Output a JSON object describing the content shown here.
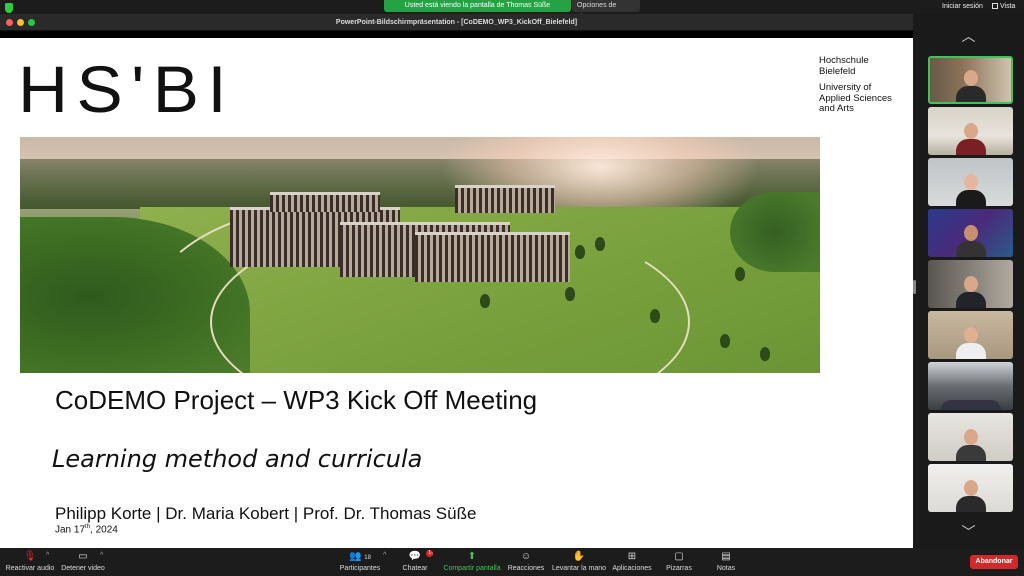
{
  "topbar": {
    "share_banner": "Usted está viendo la pantalla de Thomas Süße",
    "view_options": "Opciones de vista",
    "signin": "Iniciar sesión",
    "vista": "Vista"
  },
  "window": {
    "title": "PowerPoint-Bildschirmpräsentation - [CoDEMO_WP3_KickOff_Bielefeld]"
  },
  "slide": {
    "logo": "HS'BI",
    "institution": [
      "Hochschule",
      "Bielefeld"
    ],
    "institution_en": [
      "University of",
      "Applied Sciences",
      "and Arts"
    ],
    "title": "CoDEMO Project – WP3 Kick Off Meeting",
    "subtitle": "Learning method and curricula",
    "authors": "Philipp Korte | Dr. Maria Kobert | Prof. Dr. Thomas Süße",
    "date_day": "Jan 17",
    "date_sup": "th",
    "date_year": ", 2024"
  },
  "participants_count": "18",
  "chat_badge": "1",
  "toolbar": {
    "audio": "Reactivar audio",
    "video": "Detener video",
    "participants": "Participantes",
    "chat": "Chatear",
    "share": "Compartir pantalla",
    "reactions": "Reacciones",
    "raise_hand": "Levantar la mano",
    "apps": "Aplicaciones",
    "whiteboards": "Pizarras",
    "notes": "Notas",
    "leave": "Abandonar"
  },
  "colors": {
    "accent_green": "#3ec45a",
    "leave_red": "#d22a2a",
    "share_banner": "#25a244"
  }
}
